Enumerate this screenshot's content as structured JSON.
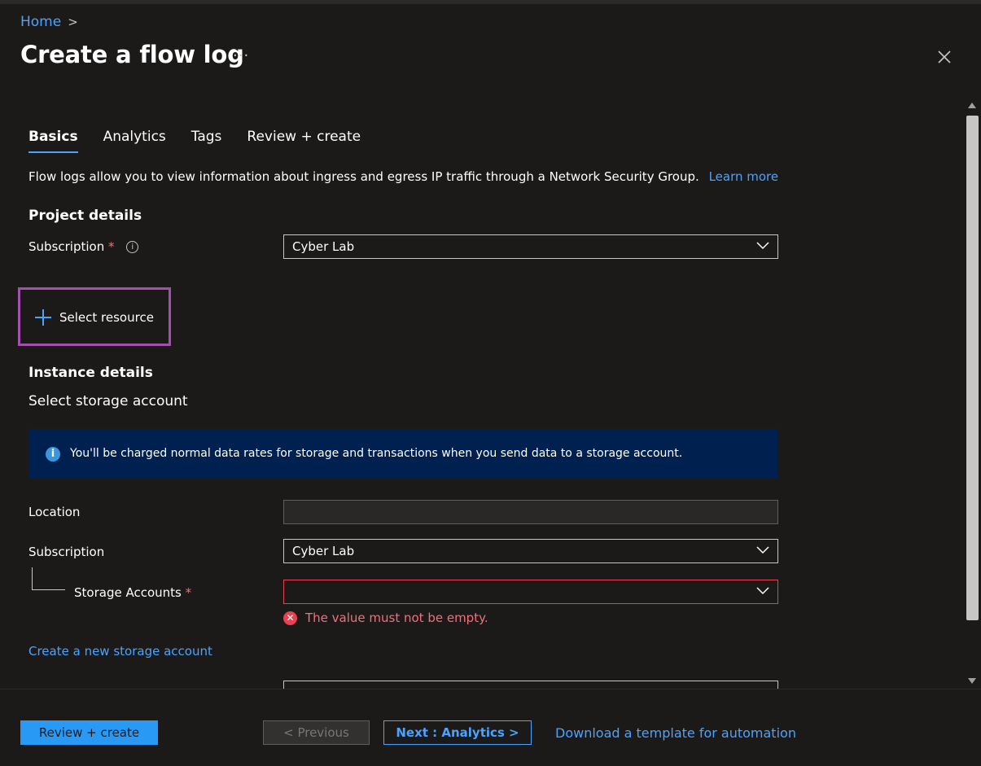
{
  "breadcrumb": {
    "home": "Home",
    "separator": ">"
  },
  "header": {
    "title": "Create a flow log",
    "more": "···"
  },
  "tabs": [
    {
      "label": "Basics",
      "active": true
    },
    {
      "label": "Analytics",
      "active": false
    },
    {
      "label": "Tags",
      "active": false
    },
    {
      "label": "Review + create",
      "active": false
    }
  ],
  "intro": {
    "text": "Flow logs allow you to view information about ingress and egress IP traffic through a Network Security Group.",
    "link": "Learn more"
  },
  "project": {
    "heading": "Project details",
    "subscription_label": "Subscription",
    "required_mark": "*",
    "info": "i",
    "subscription_value": "Cyber Lab"
  },
  "select_resource": {
    "label": "Select resource"
  },
  "instance": {
    "heading": "Instance details",
    "subheading": "Select storage account",
    "banner_icon": "i",
    "banner_text": "You'll be charged normal data rates for storage and transactions when you send data to a storage account.",
    "location_label": "Location",
    "location_value": "",
    "subscription_label": "Subscription",
    "subscription_value": "Cyber Lab",
    "storage_label": "Storage Accounts",
    "required_mark": "*",
    "storage_value": "",
    "error_icon": "✕",
    "error_text": "The value must not be empty.",
    "create_link": "Create a new storage account"
  },
  "footer": {
    "review_create": "Review + create",
    "previous": "< Previous",
    "next": "Next : Analytics >",
    "download": "Download a template for automation"
  },
  "colors": {
    "background": "#1b1a19",
    "accent": "#4aa3ff",
    "primary_button": "#2899f5",
    "error": "#e8414f",
    "info_banner": "#002050",
    "highlight_box": "#a24fb0"
  }
}
